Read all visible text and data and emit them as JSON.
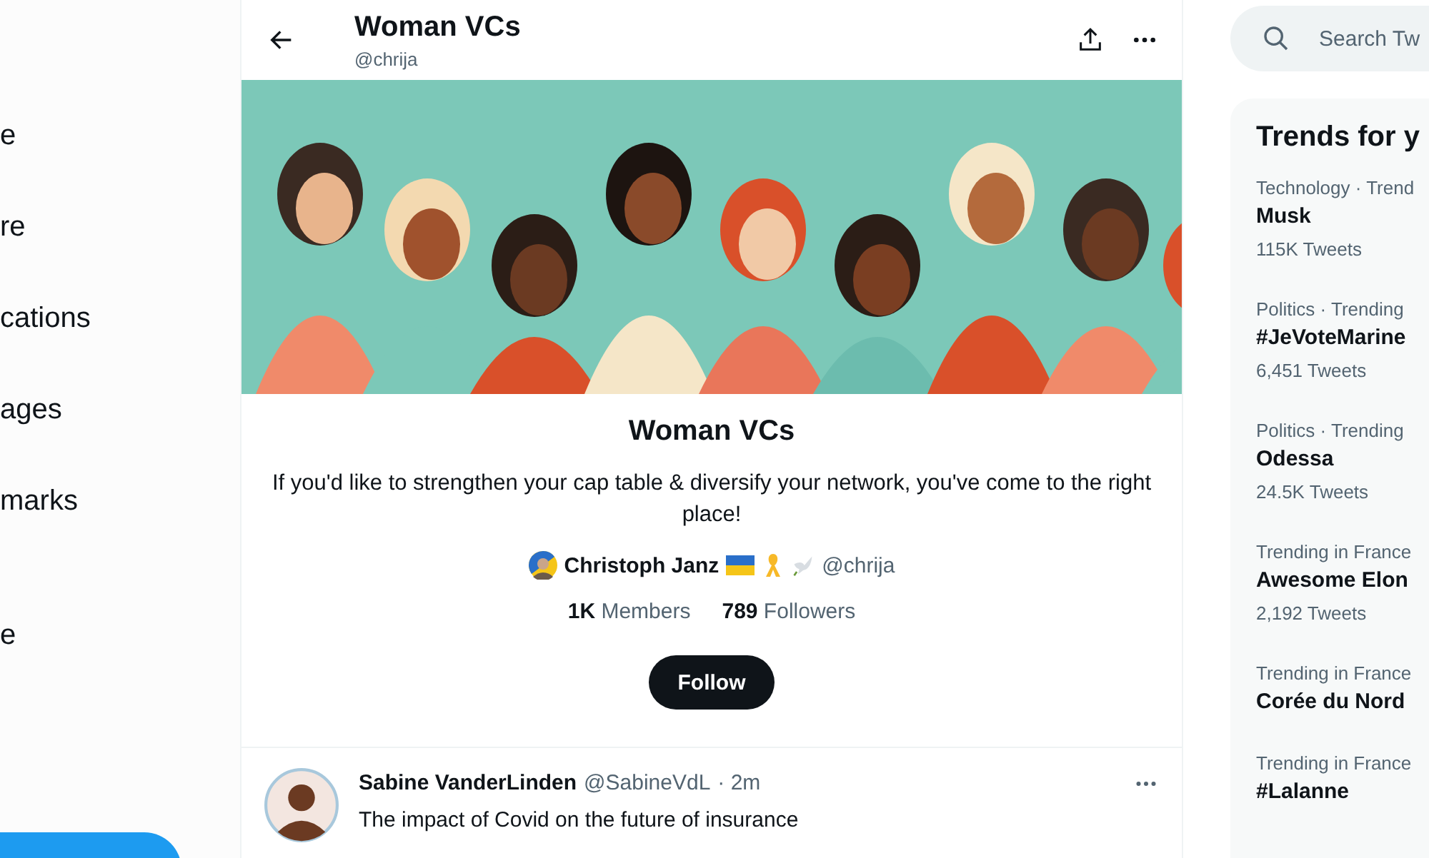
{
  "nav": {
    "items": [
      "e",
      "re",
      "cations",
      "ages",
      "marks",
      "e"
    ]
  },
  "header": {
    "title": "Woman VCs",
    "handle": "@chrija"
  },
  "list": {
    "name": "Woman VCs",
    "description": "If you'd like to strengthen your cap table & diversify your network, you've come to the right place!",
    "owner": {
      "name": "Christoph Janz",
      "handle": "@chrija"
    },
    "stats": [
      {
        "count": "1K",
        "label": "Members"
      },
      {
        "count": "789",
        "label": "Followers"
      }
    ],
    "follow_button": "Follow"
  },
  "tweet": {
    "name": "Sabine VanderLinden",
    "handle": "@SabineVdL",
    "time": "· 2m",
    "text": "The impact of Covid on the future of insurance"
  },
  "search": {
    "placeholder": "Search Tw"
  },
  "trends": {
    "title": "Trends for y",
    "items": [
      {
        "context": "Technology · Trend",
        "name": "Musk",
        "count": "115K Tweets"
      },
      {
        "context": "Politics · Trending",
        "name": "#JeVoteMarine",
        "count": "6,451 Tweets"
      },
      {
        "context": "Politics · Trending",
        "name": "Odessa",
        "count": "24.5K Tweets"
      },
      {
        "context": "Trending in France",
        "name": "Awesome Elon",
        "count": "2,192 Tweets"
      },
      {
        "context": "Trending in France",
        "name": "Corée du Nord"
      },
      {
        "context": "Trending in France",
        "name": "#Lalanne"
      }
    ]
  }
}
